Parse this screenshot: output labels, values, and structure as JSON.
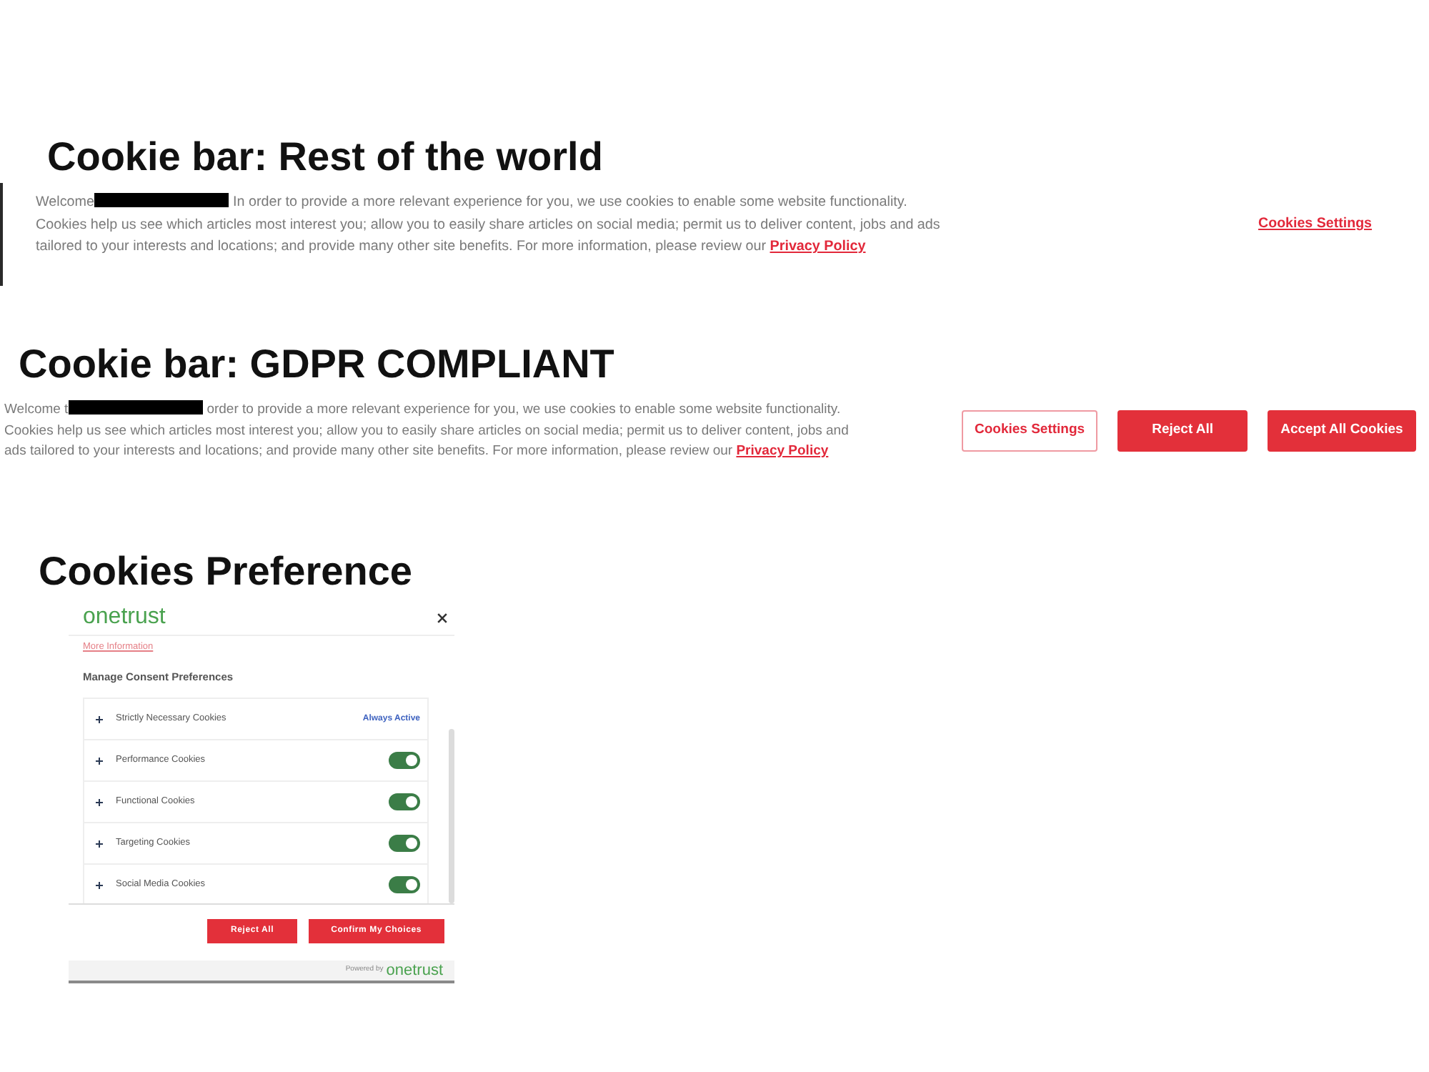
{
  "rest_of_world": {
    "heading": "Cookie bar: Rest of the world",
    "message": {
      "text_before": "Welcome",
      "redacted": true,
      "text_after": "In order to provide a more relevant experience for you, we use cookies to enable some website functionality. Cookies help us see which articles most interest you; allow you to easily share articles on social media; permit us to deliver content, jobs and ads tailored to your interests and locations; and provide many other site benefits. For more information, please review our",
      "link": "Privacy Policy"
    },
    "buttons": [
      {
        "label": "Cookies Settings",
        "kind": "link"
      }
    ]
  },
  "gdpr_compliant": {
    "heading": "Cookie bar: GDPR COMPLIANT",
    "message": {
      "text_before": "Welcome t",
      "redacted": true,
      "text_after": "order to provide a more relevant experience for you, we use cookies to enable some website functionality. Cookies help us see which articles most interest you; allow you to easily share articles on social media; permit us to deliver content, jobs and ads tailored to your interests and locations; and provide many other site benefits. For more information, please review our",
      "link": "Privacy Policy"
    },
    "buttons": [
      {
        "label": "Cookies Settings",
        "kind": "outline"
      },
      {
        "label": "Reject All",
        "kind": "filled"
      },
      {
        "label": "Accept All Cookies",
        "kind": "filled"
      }
    ]
  },
  "cookies_preference": {
    "heading": "Cookies Preference",
    "logo": "onetrust",
    "more_information_link": "More Information",
    "title": "Manage Consent Preferences",
    "categories": [
      {
        "label": "Strictly Necessary Cookies",
        "kind": "status",
        "status": "Always Active"
      },
      {
        "label": "Performance Cookies",
        "kind": "toggle",
        "on": true
      },
      {
        "label": "Functional Cookies",
        "kind": "toggle",
        "on": true
      },
      {
        "label": "Targeting Cookies",
        "kind": "toggle",
        "on": true
      },
      {
        "label": "Social Media Cookies",
        "kind": "toggle",
        "on": true
      }
    ],
    "buttons": [
      "Reject All",
      "Confirm My Choices"
    ],
    "footer": {
      "powered_by": "Powered by",
      "logo": "onetrust"
    }
  }
}
